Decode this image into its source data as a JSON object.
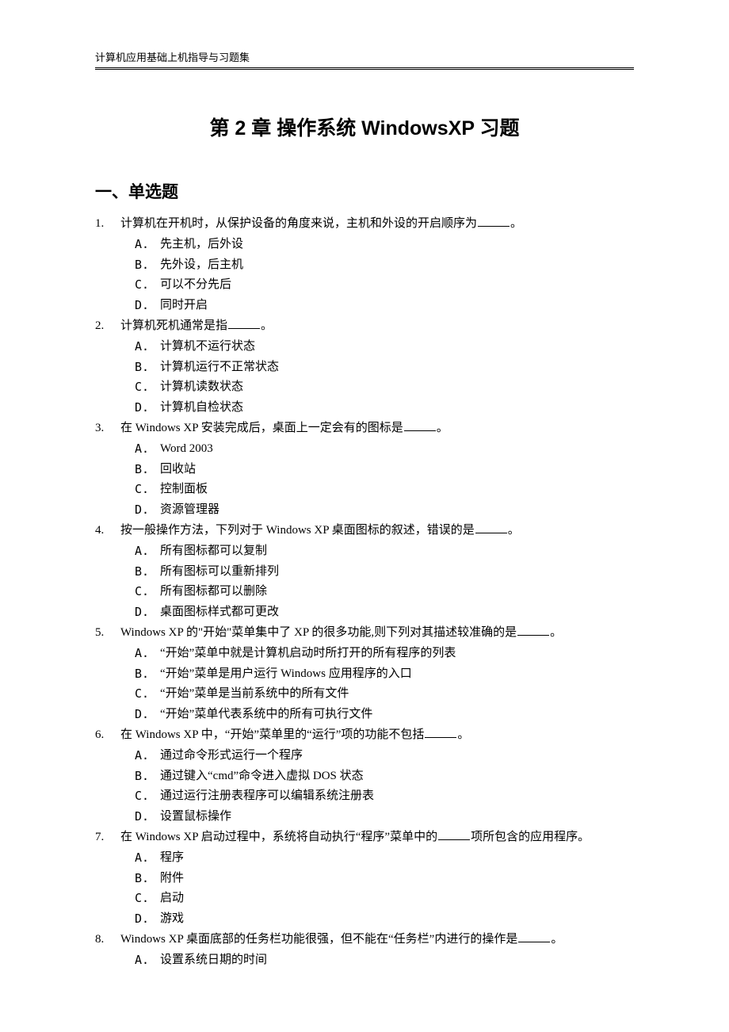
{
  "running_header": "计算机应用基础上机指导与习题集",
  "chapter_title": "第 2 章  操作系统 WindowsXP 习题",
  "section_title": "一、单选题",
  "questions": [
    {
      "num": "1.",
      "stem_parts": [
        "计算机在开机时，从保护设备的角度来说，主机和外设的开启顺序为",
        "BLANK",
        "。"
      ],
      "options": [
        {
          "label": "A.",
          "text": "先主机，后外设"
        },
        {
          "label": "B.",
          "text": "先外设，后主机"
        },
        {
          "label": "C.",
          "text": "可以不分先后"
        },
        {
          "label": "D.",
          "text": "同时开启"
        }
      ]
    },
    {
      "num": "2.",
      "stem_parts": [
        "计算机死机通常是指",
        "BLANK",
        "。"
      ],
      "options": [
        {
          "label": "A.",
          "text": "计算机不运行状态"
        },
        {
          "label": "B.",
          "text": "计算机运行不正常状态"
        },
        {
          "label": "C.",
          "text": "计算机读数状态"
        },
        {
          "label": "D.",
          "text": "计算机自检状态"
        }
      ]
    },
    {
      "num": "3.",
      "stem_parts": [
        "在 Windows XP 安装完成后，桌面上一定会有的图标是",
        "BLANK",
        "。"
      ],
      "options": [
        {
          "label": "A.",
          "text": "Word 2003"
        },
        {
          "label": "B.",
          "text": "回收站"
        },
        {
          "label": "C.",
          "text": "控制面板"
        },
        {
          "label": "D.",
          "text": "资源管理器"
        }
      ]
    },
    {
      "num": "4.",
      "stem_parts": [
        "按一般操作方法，下列对于 Windows XP 桌面图标的叙述，错误的是",
        "BLANK",
        "。"
      ],
      "options": [
        {
          "label": "A.",
          "text": "所有图标都可以复制"
        },
        {
          "label": "B.",
          "text": "所有图标可以重新排列"
        },
        {
          "label": "C.",
          "text": "所有图标都可以删除"
        },
        {
          "label": "D.",
          "text": "桌面图标样式都可更改"
        }
      ]
    },
    {
      "num": "5.",
      "stem_parts": [
        "Windows XP 的\"开始\"菜单集中了 XP 的很多功能,则下列对其描述较准确的是",
        "BLANK",
        "。"
      ],
      "options": [
        {
          "label": "A.",
          "text": "“开始”菜单中就是计算机启动时所打开的所有程序的列表"
        },
        {
          "label": "B.",
          "text": "“开始”菜单是用户运行 Windows 应用程序的入口"
        },
        {
          "label": "C.",
          "text": "“开始”菜单是当前系统中的所有文件"
        },
        {
          "label": "D.",
          "text": "“开始”菜单代表系统中的所有可执行文件"
        }
      ]
    },
    {
      "num": "6.",
      "stem_parts": [
        "在 Windows XP 中，“开始”菜单里的“运行”项的功能不包括",
        "BLANK",
        "。"
      ],
      "options": [
        {
          "label": "A.",
          "text": "通过命令形式运行一个程序"
        },
        {
          "label": "B.",
          "text": "通过键入“cmd”命令进入虚拟 DOS 状态"
        },
        {
          "label": "C.",
          "text": "通过运行注册表程序可以编辑系统注册表"
        },
        {
          "label": "D.",
          "text": "设置鼠标操作"
        }
      ]
    },
    {
      "num": "7.",
      "stem_parts": [
        "在 Windows XP 启动过程中，系统将自动执行“程序”菜单中的",
        "BLANK",
        "项所包含的应用程序。"
      ],
      "options": [
        {
          "label": "A.",
          "text": "程序"
        },
        {
          "label": "B.",
          "text": "附件"
        },
        {
          "label": "C.",
          "text": "启动"
        },
        {
          "label": "D.",
          "text": "游戏"
        }
      ]
    },
    {
      "num": "8.",
      "stem_parts": [
        "Windows XP 桌面底部的任务栏功能很强，但不能在“任务栏”内进行的操作是",
        "BLANK",
        "。"
      ],
      "options": [
        {
          "label": "A.",
          "text": "设置系统日期的时间"
        }
      ]
    }
  ]
}
